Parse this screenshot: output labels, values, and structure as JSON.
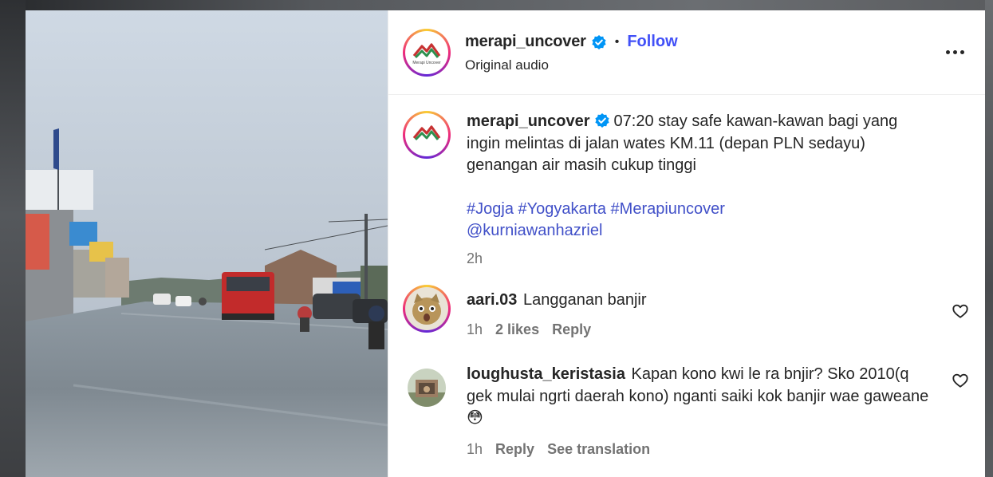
{
  "post": {
    "username": "merapi_uncover",
    "follow_label": "Follow",
    "dot": "•",
    "audio_label": "Original audio",
    "avatar_logo_text": "Merapi Uncover",
    "caption": "07:20 stay safe kawan-kawan bagi yang ingin melintas di jalan wates KM.11 (depan PLN sedayu) genangan air masih cukup tinggi",
    "hashtags": [
      "#Jogja",
      "#Yogyakarta",
      "#Merapiuncover"
    ],
    "mention": "@kurniawanhazriel",
    "time_ago": "2h"
  },
  "comments": [
    {
      "username": "aari.03",
      "text": "Langganan banjir",
      "time_ago": "1h",
      "likes_label": "2 likes",
      "reply_label": "Reply"
    },
    {
      "username": "loughusta_keristasia",
      "text": "Kapan kono kwi le ra bnjir? Sko 2010(q gek mulai ngrti daerah kono) nganti saiki kok banjir wae gaweane😳",
      "time_ago": "1h",
      "reply_label": "Reply",
      "translation_label": "See translation"
    }
  ],
  "icons": {
    "more": "more-options-icon",
    "verified": "verified-badge-icon",
    "heart": "heart-outline-icon"
  },
  "colors": {
    "follow_blue": "#4150f7",
    "verified_blue": "#0095f6",
    "hashtag_blue": "#4150c8",
    "meta_gray": "#737373"
  }
}
